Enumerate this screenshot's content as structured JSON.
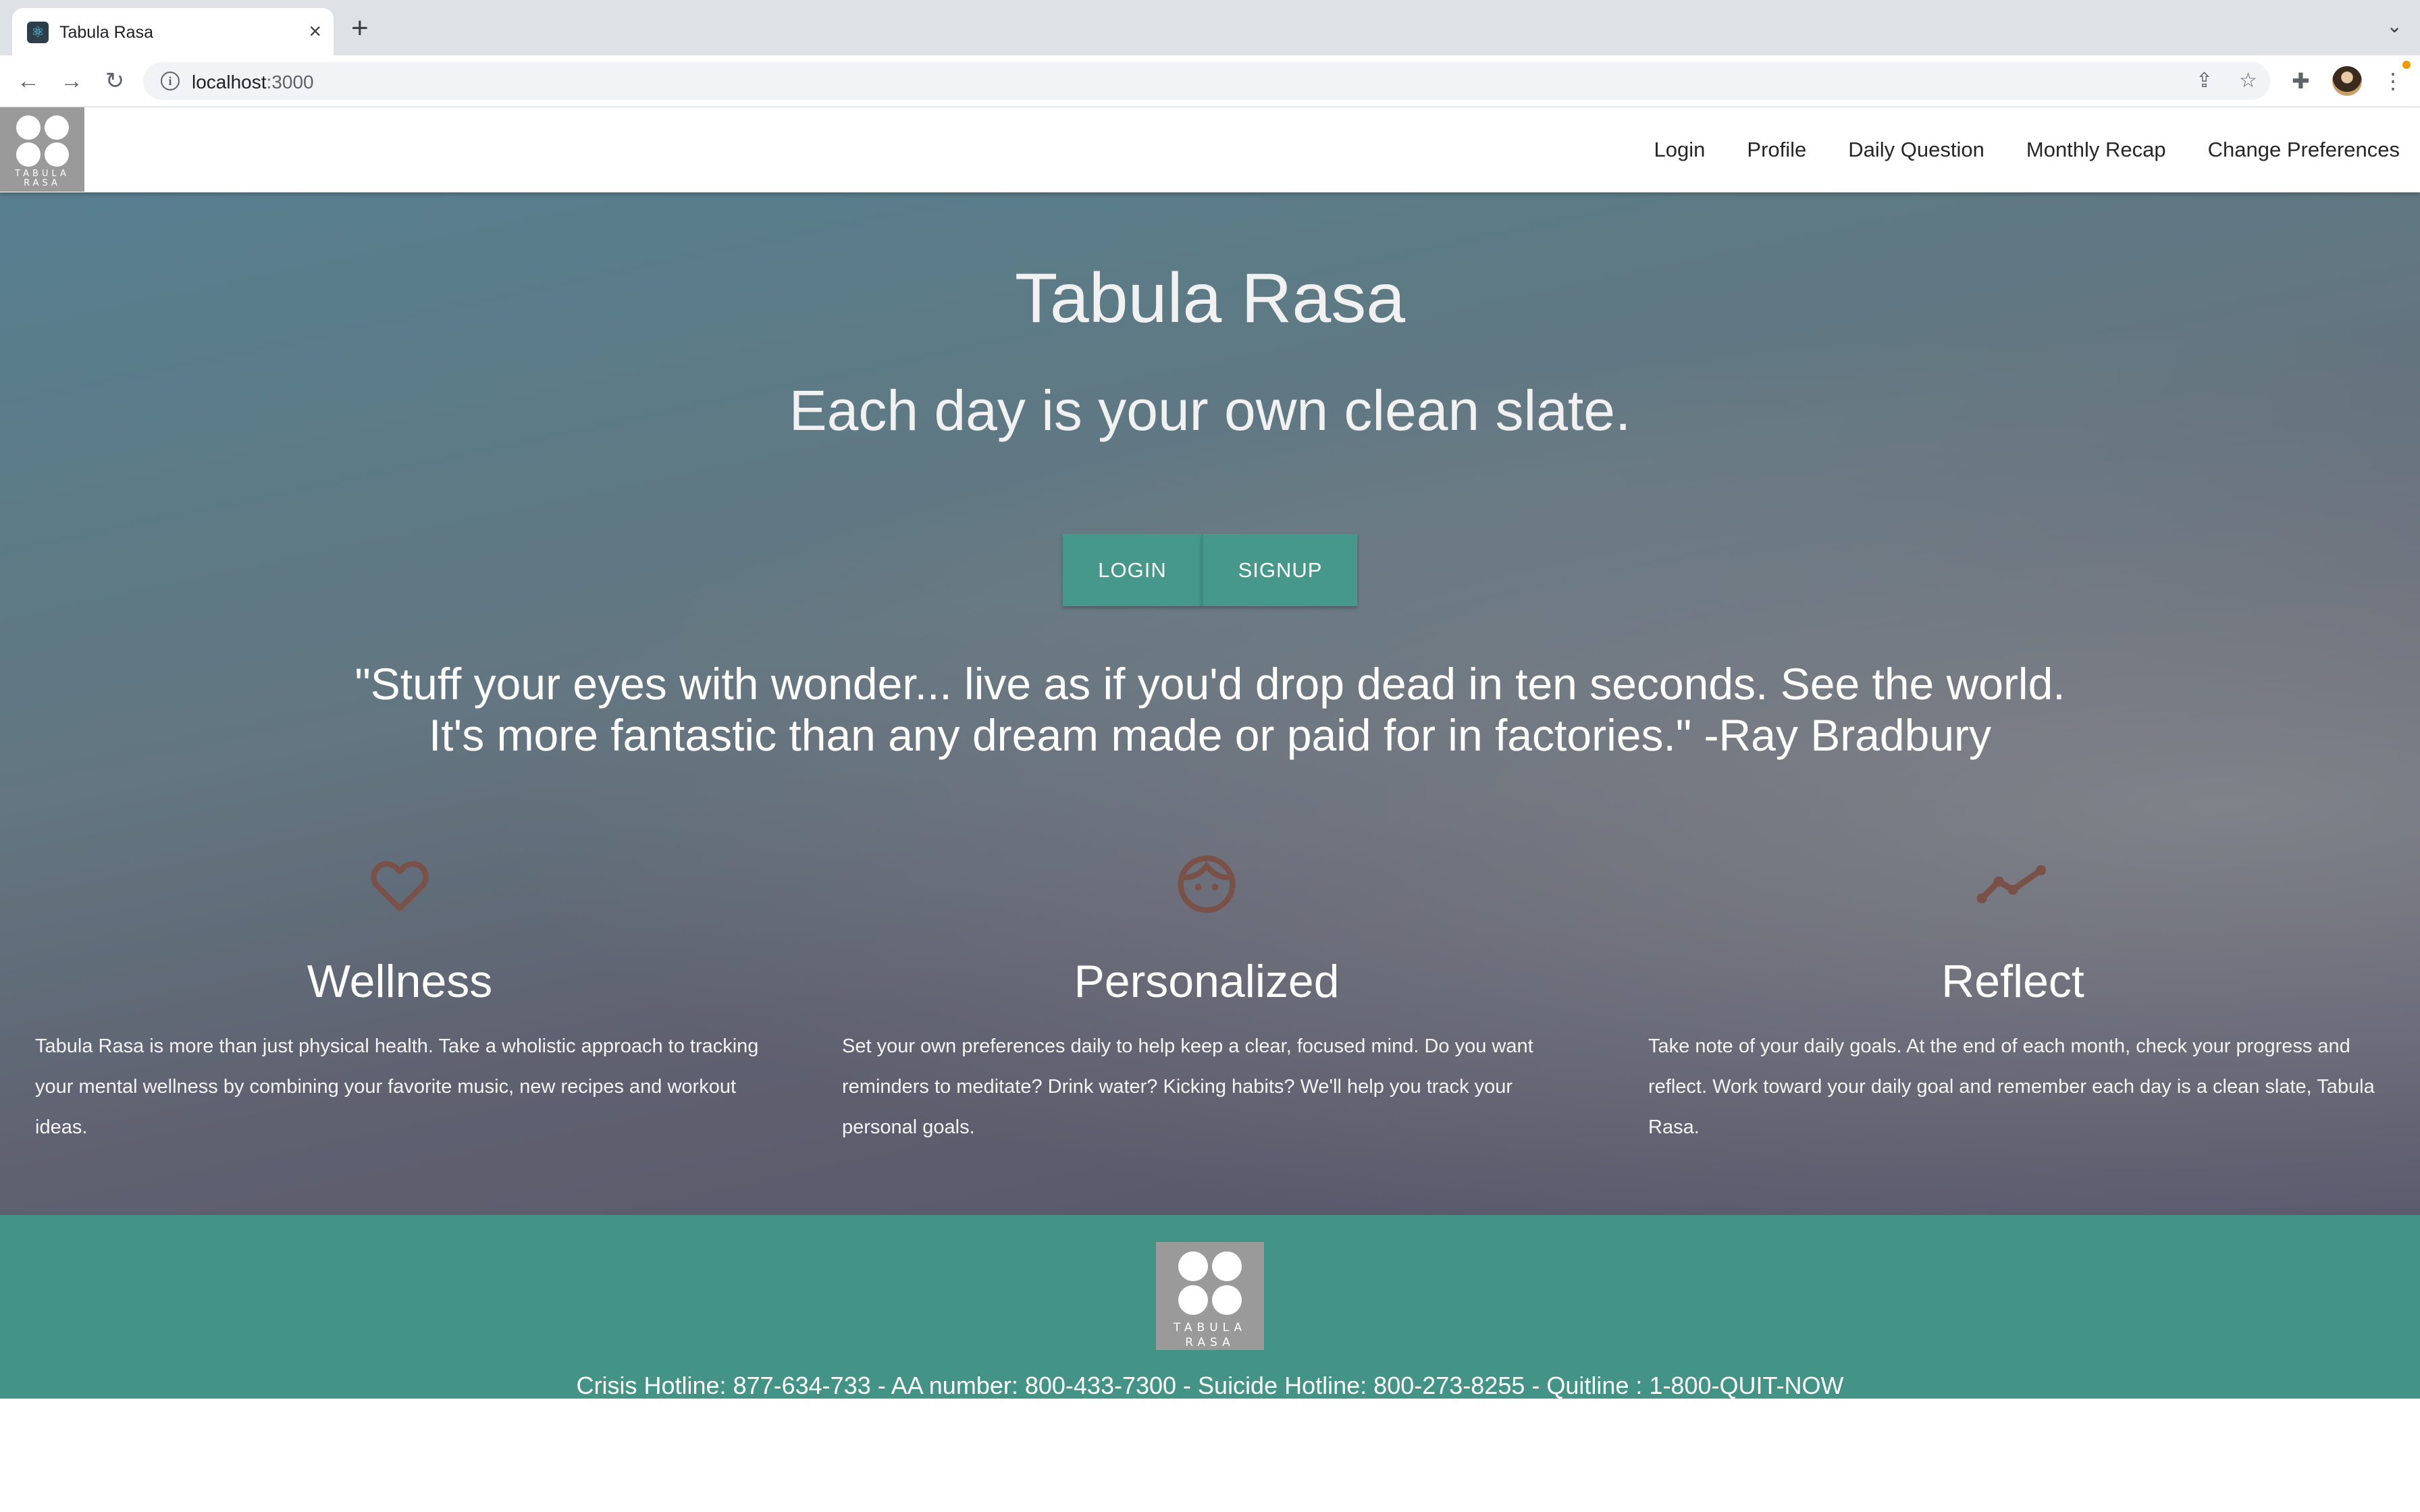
{
  "browser": {
    "tab_title": "Tabula Rasa",
    "url_host": "localhost",
    "url_port": ":3000"
  },
  "navbar": {
    "logo_text": "TABULA RASA",
    "links": [
      "Login",
      "Profile",
      "Daily Question",
      "Monthly Recap",
      "Change Preferences"
    ]
  },
  "hero": {
    "title": "Tabula Rasa",
    "subtitle": "Each day is your own clean slate.",
    "login_label": "LOGIN",
    "signup_label": "SIGNUP",
    "quote_line1": "\"Stuff your eyes with wonder... live as if you'd drop dead in ten seconds. See the world.",
    "quote_line2": "It's more fantastic than any dream made or paid for in factories.\" -Ray Bradbury"
  },
  "features": [
    {
      "icon": "heart-icon",
      "title": "Wellness",
      "text": "Tabula Rasa is more than just physical health. Take a wholistic approach to tracking your mental wellness by combining your favorite music, new recipes and workout ideas."
    },
    {
      "icon": "face-icon",
      "title": "Personalized",
      "text": "Set your own preferences daily to help keep a clear, focused mind. Do you want reminders to meditate? Drink water? Kicking habits? We'll help you track your personal goals."
    },
    {
      "icon": "trending-line-icon",
      "title": "Reflect",
      "text": "Take note of your daily goals. At the end of each month, check your progress and reflect. Work toward your daily goal and remember each day is a clean slate, Tabula Rasa."
    }
  ],
  "footer": {
    "logo_text": "TABULA RASA",
    "hotlines": "Crisis Hotline: 877-634-733 - AA number: 800-433-7300 - Suicide Hotline: 800-273-8255 - Quitline : 1-800-QUIT-NOW"
  },
  "colors": {
    "accent": "#45988a",
    "footer_bg": "#439387",
    "icon": "#7a5148",
    "logo_bg": "#9a9a9a"
  }
}
